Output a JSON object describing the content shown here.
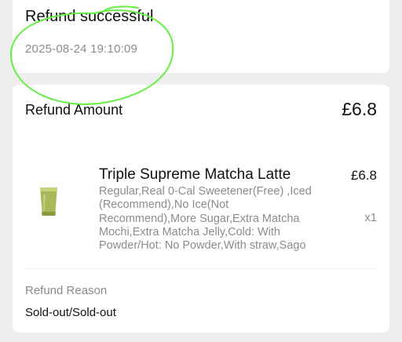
{
  "status": {
    "title": "Refund successful",
    "time": "2025-08-24 19:10:09"
  },
  "refund": {
    "amount_label": "Refund Amount",
    "amount_value": "£6.8"
  },
  "product": {
    "name": "Triple Supreme Matcha Latte",
    "price": "£6.8",
    "options": "Regular,Real 0-Cal Sweetener(Free) ,Iced (Recommend),No Ice(Not Recommend),More Sugar,Extra Matcha Mochi,Extra Matcha Jelly,Cold: With Powder/Hot: No Powder,With straw,Sago",
    "quantity": "x1",
    "image_icon": "matcha-cup-icon"
  },
  "reason": {
    "label": "Refund Reason",
    "value": "Sold-out/Sold-out"
  },
  "colors": {
    "background": "#efefef",
    "card": "#ffffff",
    "primary_text": "#111111",
    "secondary_text": "#8c8c8c",
    "annotation_stroke": "#66ee44"
  }
}
